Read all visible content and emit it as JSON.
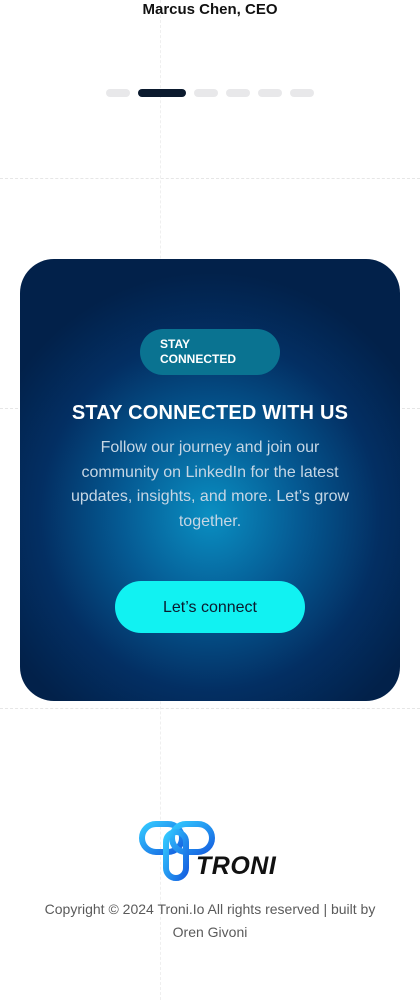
{
  "testimonial": {
    "author": "Marcus Chen, CEO"
  },
  "carousel": {
    "dot_count": 6,
    "active_index": 1
  },
  "cta_card": {
    "badge_line1": "STAY",
    "badge_line2": "CONNECTED",
    "title": "STAY CONNECTED WITH US",
    "text": "Follow our journey and join our community on LinkedIn for the latest updates, insights, and more. Let’s grow together.",
    "button_label": "Let’s connect"
  },
  "footer": {
    "logo_text": "TRONI",
    "copyright_line1": "Copyright © 2024 Troni.Io All rights reserved | built by",
    "copyright_line2": "Oren Givoni"
  },
  "colors": {
    "accent": "#11f2f2",
    "card_dark": "#02214a",
    "logo_blue": "#1e9bf0"
  }
}
